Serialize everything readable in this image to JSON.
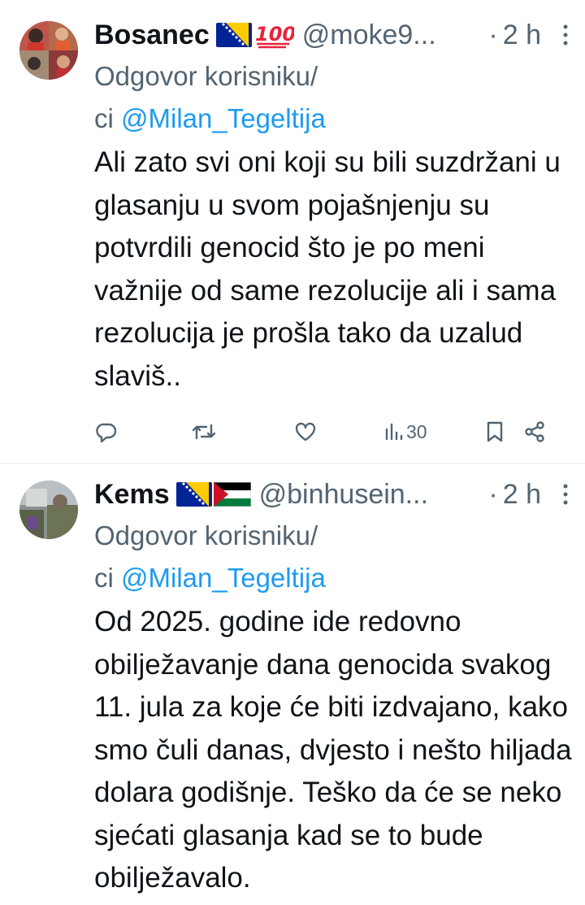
{
  "tweets": [
    {
      "name": "Bosanec",
      "handle": "@moke9...",
      "dot": "·",
      "time": "2 h",
      "emoji_text": "100",
      "reply_prefix": "Odgovor korisniku/",
      "reply_ci": "ci",
      "mention": "@Milan_Tegeltija",
      "body": "Ali zato svi oni koji su bili suzdržani u glasanju u svom pojašnjenju su potvrdili genocid što je po meni važnije od same rezolucije ali i sama rezolucija je prošla tako da uzalud slaviš..",
      "views": "30"
    },
    {
      "name": "Kems",
      "handle": "@binhusein...",
      "dot": "·",
      "time": "2 h",
      "reply_prefix": "Odgovor korisniku/",
      "reply_ci": "ci",
      "mention": "@Milan_Tegeltija",
      "body": "Od 2025. godine ide redovno obilježavanje dana genocida svakog 11. jula za koje će biti izdvajano, kako smo čuli danas, dvjesto i nešto hiljada dolara godišnje. Teško da će se neko sjećati glasanja kad se to bude obilježavalo."
    }
  ],
  "colors": {
    "text": "#0f1419",
    "secondary": "#536471",
    "link": "#1d9bf0",
    "divider": "#eff3f4",
    "emoji_red": "#e8233b",
    "flag_blue": "#002395",
    "flag_yellow": "#fecb00"
  },
  "icons": [
    "more-icon",
    "reply-icon",
    "retweet-icon",
    "like-icon",
    "views-icon",
    "bookmark-icon",
    "share-icon",
    "bosnia-flag-icon",
    "palestine-flag-icon",
    "hundred-points-icon"
  ]
}
